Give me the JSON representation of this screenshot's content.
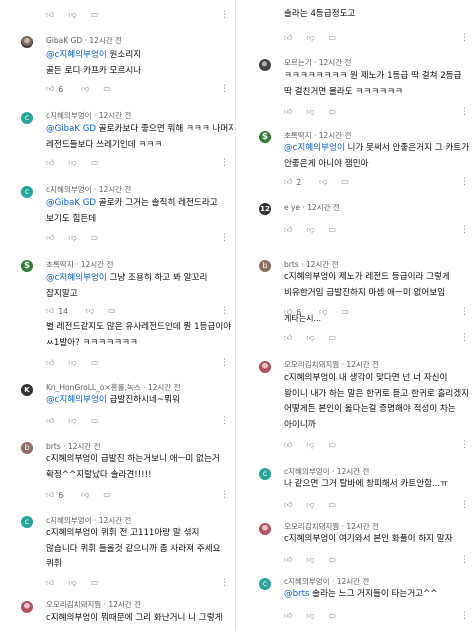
{
  "icons": {
    "like": "thumbs-up-icon",
    "dislike": "thumbs-down-icon",
    "reply": "reply-icon",
    "more": "more-vertical-icon"
  },
  "left": [
    {
      "author": "",
      "time": "",
      "mention": "",
      "lines": [],
      "likes": ""
    },
    {
      "author": "GibaK GD",
      "time": "12시간 전",
      "mention": "@c지혜의부엉이",
      "lines": [
        "원소리지",
        "골든 로디 카프카 모르시나"
      ],
      "likes": "6"
    },
    {
      "author": "c지혜의부엉이",
      "time": "12시간 전",
      "mention": "@GibaK GD",
      "lines": [
        "골로카보다 좋으면 뭐해 ㅋㅋㅋ 나머지",
        "레전드들보다 쓰레기인데 ㅋㅋㅋ"
      ],
      "likes": ""
    },
    {
      "author": "c지혜의부엉이",
      "time": "12시간 전",
      "mention": "@GibaK GD",
      "lines": [
        "골로카 그거는 솔직히 레전드라고",
        "보기도 힘든데"
      ],
      "likes": ""
    },
    {
      "author": "초록딱지",
      "time": "12시간 전",
      "mention": "@c지혜의부엉이",
      "lines": [
        "그냥 조용히 하고 봐 알꼬리",
        "잡지말고"
      ],
      "likes": "14"
    },
    {
      "author": "",
      "time": "",
      "mention": "",
      "lines": [
        "별 레전드같지도 않은 유사레전드인데 뭔 1등급이야",
        "ㅆ1발아? ㅋㅋㅋㅋㅋㅋㅋ"
      ],
      "likes": ""
    },
    {
      "author": "Kn_HonGroLL_o×홍롤,녹스",
      "time": "12시간 전",
      "mention": "@c지혜의부엉이",
      "lines": [
        "급발진하시네~뭐워"
      ],
      "likes": ""
    },
    {
      "author": "brts",
      "time": "12시간 전",
      "mention": "",
      "lines": [
        "c지혜의부엉이 급발진 하는거보니 애ㅡ미 없는거",
        "확정^^지랄났다 솔라견!!!!!"
      ],
      "likes": "6"
    },
    {
      "author": "c지혜의부엉이",
      "time": "12시간 전",
      "mention": "",
      "lines": [
        "c지혜의부엉이 퀴휘 전 고111아랑 말 섞지",
        "않습니다 퀴휘 들올것 같으니까 좀 사라져 주세요",
        "퀴휘"
      ],
      "likes": ""
    },
    {
      "author": "오모리김치돼지찜",
      "time": "12시간 전",
      "mention": "",
      "lines": [
        "c지혜의부엉이 뭐때문에 그리 화난거니 니 그렇게"
      ],
      "likes": ""
    }
  ],
  "right": [
    {
      "author": "",
      "time": "",
      "mention": "",
      "lines": [
        "솔라는 4등급정도고"
      ],
      "likes": ""
    },
    {
      "author": "모르는기",
      "time": "12시간 전",
      "mention": "",
      "lines": [
        "ㅋㅋㅋㅋㅋㅋㅋㅋ 원 제노가 1등급 딱 걸쳐 2등급",
        "딱 걸친거면 몰라도 ㅋㅋㅋㅋㅋㅋ"
      ],
      "likes": ""
    },
    {
      "author": "초록딱지",
      "time": "12시간 전",
      "mention": "@c지혜의부엉이",
      "lines": [
        "니가 못써서 안좋은거지 그 카트가",
        "안좋은게 아니야 잼민아"
      ],
      "likes": "2"
    },
    {
      "author": "e ye",
      "time": "12시간 전",
      "mention": "",
      "lines": [],
      "likes": ""
    },
    {
      "author": "brts",
      "time": "12시간 전",
      "mention": "",
      "lines": [
        "c지혜의부엉이 제노가 레전드 등급이라 그렇게",
        "비유한거임 급발진하지 마셈 애ㅡ미 없어보임"
      ],
      "likes": "6"
    },
    {
      "author": "",
      "time": "",
      "mention": "",
      "lines": [
        "게타는시..."
      ],
      "likes": ""
    },
    {
      "author": "오모리김치돼지찜",
      "time": "12시간 전",
      "mention": "",
      "lines": [
        "c지혜의부엉이 내 생각이 맞다면 넌 너 자신이",
        "왕이니 내가 하는 말은 한귀로 듣고 한귀로 흘리겠지",
        "어떻게든 본인이 옳다는걸 증명해야 적성이 차는",
        "아이니까"
      ],
      "likes": ""
    },
    {
      "author": "c지혜의부엉이",
      "time": "12시간 전",
      "mention": "",
      "lines": [
        "나 같으면 그거 탈바에 창피해서 카트안함...ㅠ"
      ],
      "likes": ""
    },
    {
      "author": "오모리김치돼지찜",
      "time": "12시간 전",
      "mention": "",
      "lines": [
        "c지혜의부엉이 여기와서 본인 화풀이 하지 말자"
      ],
      "likes": ""
    },
    {
      "author": "c지혜의부엉이",
      "time": "12시간 전",
      "mention": "@brts",
      "lines": [
        "솔라는 느그 거지들이 타는거고^^"
      ],
      "likes": ""
    }
  ]
}
